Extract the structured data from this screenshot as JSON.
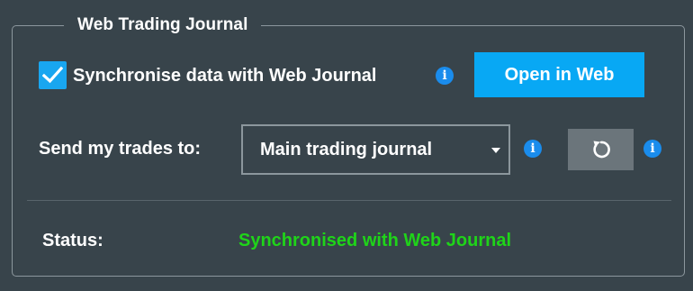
{
  "group": {
    "title": "Web Trading Journal"
  },
  "sync": {
    "checked": true,
    "label": "Synchronise data with Web Journal",
    "info_icon": "info-icon",
    "open_button_label": "Open in Web"
  },
  "send": {
    "label": "Send my trades to:",
    "selected_journal": "Main trading journal",
    "dropdown_icon": "caret-down-icon",
    "info_icon": "info-icon",
    "refresh_icon": "refresh-icon",
    "refresh_info_icon": "info-icon"
  },
  "status": {
    "label": "Status:",
    "value": "Synchronised with Web Journal",
    "value_color": "#1fd419"
  },
  "colors": {
    "background": "#38444b",
    "accent": "#08a8f4",
    "border": "#8c979d",
    "info": "#1a8cec",
    "button_secondary": "#6b757b"
  }
}
